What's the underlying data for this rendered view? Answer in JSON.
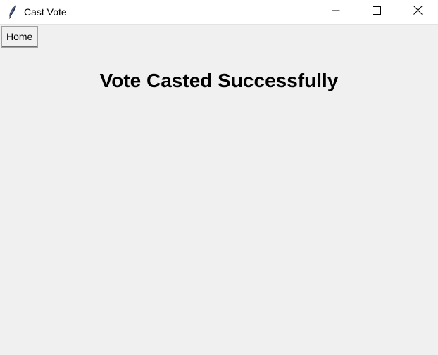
{
  "window": {
    "title": "Cast Vote",
    "icon": "feather-icon",
    "controls": {
      "minimize_icon": "minimize-icon",
      "maximize_icon": "maximize-icon",
      "close_icon": "close-icon"
    }
  },
  "toolbar": {
    "home_label": "Home"
  },
  "main": {
    "message": "Vote Casted Successfully"
  },
  "colors": {
    "background": "#f0f0f0",
    "titlebar": "#ffffff",
    "text": "#000000"
  }
}
